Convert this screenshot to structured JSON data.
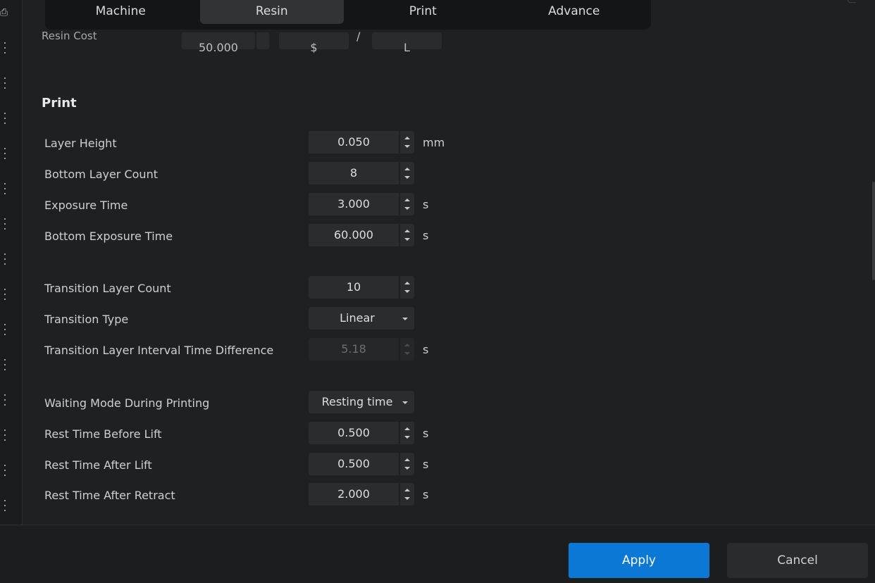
{
  "tabs": [
    {
      "label": "Machine",
      "active": false
    },
    {
      "label": "Resin",
      "active": true
    },
    {
      "label": "Print",
      "active": false
    },
    {
      "label": "Advance",
      "active": false
    }
  ],
  "resin_cost_row": {
    "label": "Resin Cost",
    "value": "50.000",
    "currency": "$",
    "separator": "/",
    "volume_unit": "L"
  },
  "print_section": {
    "title": "Print",
    "layer_height": {
      "label": "Layer Height",
      "value": "0.050",
      "unit": "mm"
    },
    "bottom_layer_count": {
      "label": "Bottom Layer Count",
      "value": "8"
    },
    "exposure_time": {
      "label": "Exposure Time",
      "value": "3.000",
      "unit": "s"
    },
    "bottom_exposure_time": {
      "label": "Bottom Exposure Time",
      "value": "60.000",
      "unit": "s"
    },
    "transition_layer_count": {
      "label": "Transition Layer Count",
      "value": "10"
    },
    "transition_type": {
      "label": "Transition Type",
      "value": "Linear"
    },
    "transition_interval": {
      "label": "Transition Layer Interval Time Difference",
      "value": "5.18",
      "unit": "s"
    },
    "waiting_mode": {
      "label": "Waiting Mode During Printing",
      "value": "Resting time"
    },
    "rest_before_lift": {
      "label": "Rest Time Before Lift",
      "value": "0.500",
      "unit": "s"
    },
    "rest_after_lift": {
      "label": "Rest Time After Lift",
      "value": "0.500",
      "unit": "s"
    },
    "rest_after_retract": {
      "label": "Rest Time After Retract",
      "value": "2.000",
      "unit": "s"
    }
  },
  "footer": {
    "apply_label": "Apply",
    "cancel_label": "Cancel",
    "accent_color": "#0a78d4"
  }
}
